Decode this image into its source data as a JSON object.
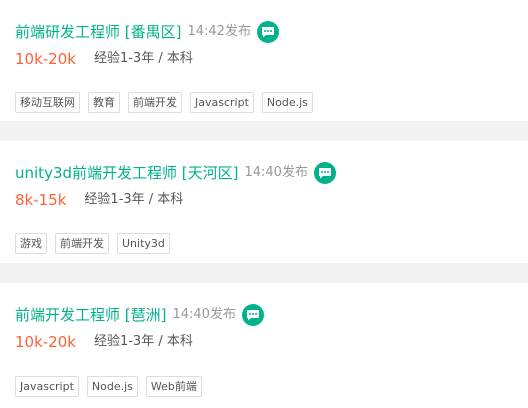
{
  "jobs": [
    {
      "title": "前端研发工程师 [番禺区]",
      "publish_time": "14:42发布",
      "salary": "10k-20k",
      "requirement": "经验1-3年 / 本科",
      "tags": [
        "移动互联网",
        "教育",
        "前端开发",
        "Javascript",
        "Node.js"
      ]
    },
    {
      "title": "unity3d前端开发工程师 [天河区]",
      "publish_time": "14:40发布",
      "salary": "8k-15k",
      "requirement": "经验1-3年 / 本科",
      "tags": [
        "游戏",
        "前端开发",
        "Unity3d"
      ]
    },
    {
      "title": "前端开发工程师 [琶洲]",
      "publish_time": "14:40发布",
      "salary": "10k-20k",
      "requirement": "经验1-3年 / 本科",
      "tags": [
        "Javascript",
        "Node.js",
        "Web前端"
      ]
    }
  ],
  "icons": {
    "chat": "chat-bubble-icon"
  },
  "colors": {
    "title": "#00b38a",
    "salary": "#fd5f39",
    "meta": "#999999",
    "tag_border": "#dddddd",
    "background": "#f3f3f3"
  }
}
